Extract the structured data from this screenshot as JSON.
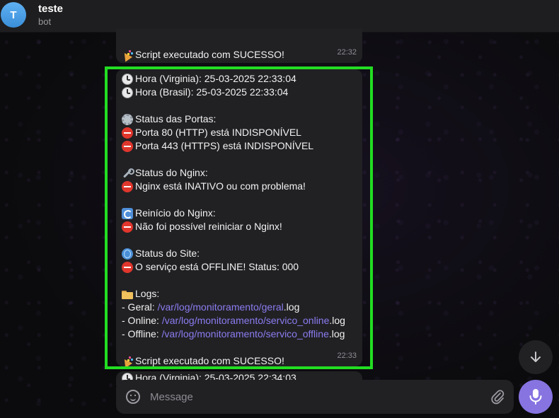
{
  "header": {
    "avatar_initial": "T",
    "chat_name": "teste",
    "chat_status": "bot"
  },
  "messages": {
    "top": {
      "text": "🎉 Script executado com SUCESSO!",
      "label": "Script executado com SUCESSO!",
      "time": "22:32"
    },
    "main": {
      "time": "22:33",
      "lines": {
        "hora_virginia": "Hora (Virginia): 25-03-2025 22:33:04",
        "hora_brasil": "Hora (Brasil): 25-03-2025 22:33:04",
        "status_portas": "Status das Portas:",
        "porta_80": "Porta 80 (HTTP) está INDISPONÍVEL",
        "porta_443": "Porta 443 (HTTPS) está INDISPONÍVEL",
        "status_nginx": "Status do Nginx:",
        "nginx_inativo": "Nginx está INATIVO ou com problema!",
        "reinicio_nginx": "Reinício do Nginx:",
        "nao_reiniciar": "Não foi possível reiniciar o Nginx!",
        "status_site": "Status do Site:",
        "servico_offline": "O serviço está OFFLINE! Status: 000",
        "logs": "Logs:",
        "log_geral_prefix": "- Geral: ",
        "log_geral_path": "/var/log/monitoramento/geral",
        "log_geral_ext": ".log",
        "log_online_prefix": "- Online: ",
        "log_online_path": "/var/log/monitoramento/servico_online",
        "log_online_ext": ".log",
        "log_offline_prefix": "- Offline: ",
        "log_offline_path": "/var/log/monitoramento/servico_offline",
        "log_offline_ext": ".log",
        "sucesso": "Script executado com SUCESSO!"
      }
    },
    "next": {
      "text": "Hora (Virginia): 25-03-2025 22:34:03"
    }
  },
  "composer": {
    "placeholder": "Message"
  },
  "colors": {
    "highlight": "#22dd22",
    "accent": "#8774e1",
    "link": "#8b7cf0"
  },
  "icons": {
    "clock": "clock-icon",
    "stop": "no-entry-icon",
    "gear": "gear-icon",
    "wrench": "wrench-icon",
    "cycle": "refresh-icon",
    "globe": "globe-icon",
    "folder": "folder-icon",
    "party": "party-popper-icon"
  }
}
